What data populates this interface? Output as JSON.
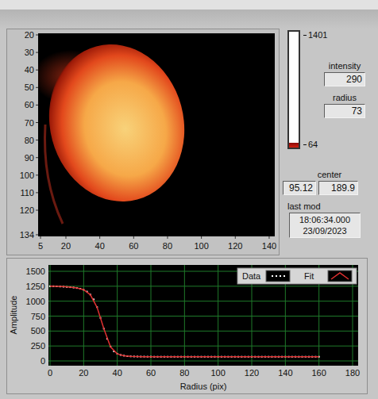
{
  "image": {
    "y_ticks": [
      "20",
      "30",
      "40",
      "50",
      "60",
      "70",
      "80",
      "90",
      "100",
      "110",
      "120",
      "134"
    ],
    "x_ticks": [
      "5",
      "20",
      "40",
      "60",
      "80",
      "100",
      "120",
      "140"
    ]
  },
  "colorbar": {
    "max": "1401",
    "min": "64"
  },
  "fields": [
    {
      "label": "intensity",
      "value": "290"
    },
    {
      "label": "radius",
      "value": "73"
    }
  ],
  "center": {
    "label": "center",
    "values": [
      "95.12",
      "189.9"
    ]
  },
  "last_mod": {
    "label": "last mod",
    "time": "18:06:34.000",
    "date": "23/09/2023"
  },
  "chart": {
    "y_label": "Amplitude",
    "x_label": "Radius (pix)",
    "y_ticks": [
      "0",
      "250",
      "500",
      "750",
      "1000",
      "1250",
      "1500"
    ],
    "x_ticks": [
      "0",
      "20",
      "40",
      "60",
      "80",
      "100",
      "120",
      "140",
      "160",
      "180"
    ],
    "series": [
      {
        "name": "Data",
        "kind": "points",
        "color": "#ffffff",
        "x": [
          0,
          2,
          4,
          6,
          8,
          10,
          12,
          14,
          16,
          18,
          20,
          22,
          24,
          26,
          28,
          30,
          32,
          34,
          36,
          38,
          40,
          42,
          44,
          46,
          48,
          50,
          52,
          54,
          56,
          58,
          60,
          62,
          64,
          66,
          68,
          70,
          72,
          74,
          76,
          78,
          80,
          82,
          84,
          86,
          88,
          90,
          92,
          94,
          96,
          98,
          100,
          102,
          104,
          106,
          108,
          110,
          112,
          114,
          116,
          118,
          120,
          122,
          124,
          126,
          128,
          130,
          132,
          134,
          136,
          138,
          140,
          142,
          144,
          146,
          148,
          150,
          152,
          154,
          156,
          158,
          160
        ],
        "values": [
          1250,
          1250,
          1248,
          1245,
          1242,
          1238,
          1234,
          1228,
          1220,
          1208,
          1190,
          1160,
          1110,
          1030,
          900,
          720,
          540,
          370,
          240,
          160,
          120,
          100,
          88,
          80,
          76,
          74,
          73,
          72,
          72,
          71,
          71,
          70,
          70,
          70,
          70,
          70,
          70,
          70,
          70,
          70,
          70,
          70,
          70,
          70,
          70,
          70,
          70,
          70,
          70,
          70,
          70,
          70,
          70,
          70,
          70,
          70,
          70,
          70,
          70,
          70,
          70,
          70,
          70,
          70,
          70,
          70,
          70,
          70,
          70,
          70,
          70,
          70,
          70,
          70,
          70,
          70,
          70,
          70,
          70,
          70,
          70
        ]
      },
      {
        "name": "Fit",
        "kind": "line",
        "color": "#e03030",
        "x": [
          0,
          4,
          8,
          12,
          16,
          20,
          24,
          28,
          32,
          36,
          40,
          44,
          48,
          52,
          56,
          60,
          64,
          68,
          72,
          76,
          80,
          84,
          88,
          92,
          96,
          100,
          104,
          108,
          112,
          116,
          120,
          124,
          128,
          132,
          136,
          140,
          144,
          148,
          152,
          156,
          160
        ],
        "values": [
          1252,
          1249,
          1243,
          1234,
          1221,
          1192,
          1108,
          895,
          540,
          236,
          118,
          86,
          76,
          72,
          70,
          70,
          70,
          70,
          70,
          70,
          70,
          70,
          70,
          70,
          70,
          70,
          70,
          70,
          70,
          70,
          70,
          70,
          70,
          70,
          70,
          70,
          70,
          70,
          70,
          70,
          70
        ]
      }
    ]
  }
}
